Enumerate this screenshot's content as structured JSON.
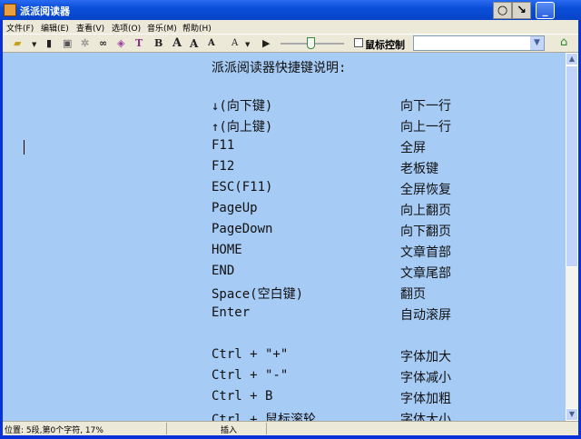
{
  "window": {
    "title": "派派阅读器"
  },
  "menu": [
    "文件(F)",
    "编辑(E)",
    "查看(V)",
    "选项(O)",
    "音乐(M)",
    "帮助(H)"
  ],
  "toolbar": {
    "bold": "B",
    "font_a": "A",
    "font_larger": "A",
    "font_smaller": "A",
    "font_color": "A",
    "mouse_control_label": "鼠标控制",
    "mouse_control_checked": false,
    "combo_value": ""
  },
  "document": {
    "title": "派派阅读器快捷键说明:",
    "rows": [
      {
        "key": "↓(向下键)",
        "desc": "向下一行"
      },
      {
        "key": "↑(向上键)",
        "desc": "向上一行"
      },
      {
        "key": "F11",
        "desc": "全屏"
      },
      {
        "key": "F12",
        "desc": "老板键"
      },
      {
        "key": "ESC(F11)",
        "desc": "全屏恢复"
      },
      {
        "key": "PageUp",
        "desc": "向上翻页"
      },
      {
        "key": "PageDown",
        "desc": "向下翻页"
      },
      {
        "key": "HOME",
        "desc": "文章首部"
      },
      {
        "key": "END",
        "desc": "文章尾部"
      },
      {
        "key": "Space(空白键)",
        "desc": "翻页"
      },
      {
        "key": "Enter",
        "desc": "自动滚屏"
      },
      {
        "key": "",
        "desc": ""
      },
      {
        "key": "Ctrl + \"+\"",
        "desc": "字体加大"
      },
      {
        "key": "Ctrl + \"-\"",
        "desc": "字体减小"
      },
      {
        "key": "Ctrl + B",
        "desc": "字体加粗"
      },
      {
        "key": "Ctrl + 鼠标滚轮",
        "desc": "字体大小"
      }
    ]
  },
  "scroll": {
    "position_percent": 17
  },
  "status": {
    "position": "位置: 5段,第0个字符, 17%",
    "mode": "插入"
  }
}
